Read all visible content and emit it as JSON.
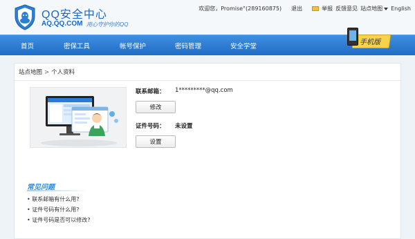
{
  "header": {
    "logo_title": "QQ安全中心",
    "logo_url": "AQ.QQ.COM",
    "logo_slogan": "用心守护你的QQ",
    "welcome": "欢迎您，Promise°(289160875)",
    "logout": "退出",
    "report": "举报",
    "feedback": "反馈意见",
    "sitemap": "站点地图",
    "language": "English",
    "mobile_promo": "手机版"
  },
  "nav": {
    "items": [
      "首页",
      "密保工具",
      "帐号保护",
      "密码管理",
      "安全学堂"
    ]
  },
  "breadcrumb": {
    "root": "站点地图",
    "separator": ">",
    "current": "个人资料"
  },
  "profile": {
    "email_label": "联系邮箱：",
    "email_value": "1*********@qq.com",
    "email_button": "修改",
    "id_label": "证件号码：",
    "id_value": "未设置",
    "id_button": "设置"
  },
  "faq": {
    "title": "常见问题",
    "items": [
      "联系邮箱有什么用?",
      "证件号码有什么用?",
      "证件号码是否可以修改?"
    ]
  },
  "colors": {
    "nav_blue": "#2a7bd6",
    "brand_blue": "#1a67c5",
    "faq_blue": "#2e8bd8",
    "promo_yellow": "#f7d34a"
  }
}
